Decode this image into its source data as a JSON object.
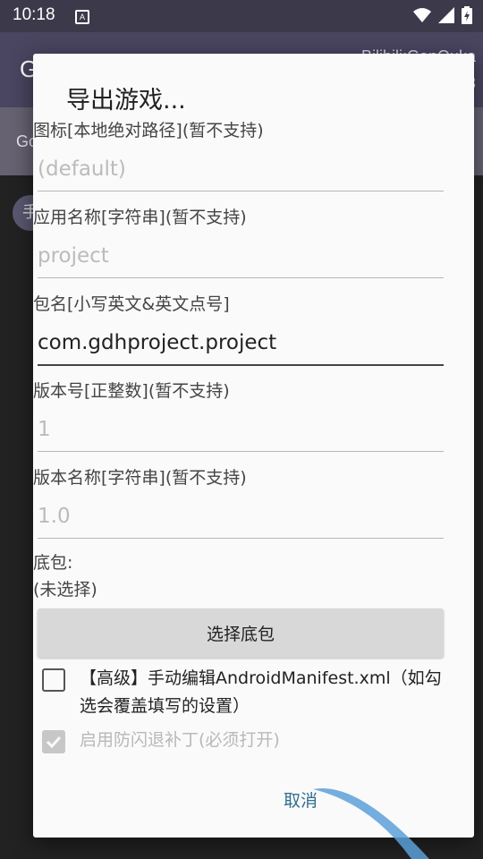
{
  "status_bar": {
    "time": "10:18",
    "notification_glyph": "A"
  },
  "background": {
    "app_title": "G",
    "credit_line1": "Bilibili:GanQuka",
    "credit_line2": "773",
    "tab_label": "Go",
    "chip_label": "手"
  },
  "dialog": {
    "title": "导出游戏...",
    "fields": [
      {
        "label": "图标[本地绝对路径](暂不支持)",
        "value": "",
        "placeholder": "(default)"
      },
      {
        "label": "应用名称[字符串](暂不支持)",
        "value": "",
        "placeholder": "project"
      },
      {
        "label": "包名[小写英文&英文点号]",
        "value": "com.gdhproject.project",
        "placeholder": ""
      },
      {
        "label": "版本号[正整数](暂不支持)",
        "value": "1",
        "placeholder": ""
      },
      {
        "label": "版本名称[字符串](暂不支持)",
        "value": "1.0",
        "placeholder": ""
      }
    ],
    "base_package_label": "底包:",
    "base_package_value": "(未选择)",
    "select_button": "选择底包",
    "checkbox_advanced": "【高级】手动编辑AndroidManifest.xml（如勾选会覆盖填写的设置）",
    "checkbox_patch": "启用防闪退补丁(必须打开)",
    "cancel_button": "取消"
  },
  "colors": {
    "accent": "#2f6f8f",
    "dialog_bg": "#fafafa",
    "toolbar": "#4a4560"
  },
  "icons": [
    "wifi-icon",
    "signal-icon",
    "battery-icon",
    "check-icon"
  ]
}
